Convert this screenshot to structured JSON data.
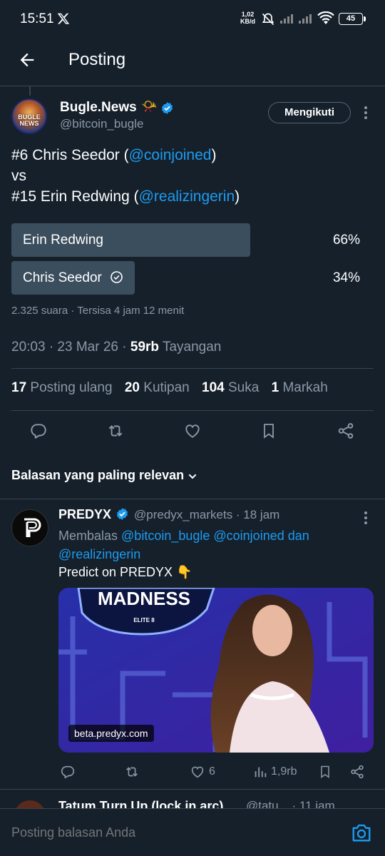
{
  "status_bar": {
    "time": "15:51",
    "net_speed_value": "1,02",
    "net_speed_unit": "KB/d",
    "battery": "45"
  },
  "header": {
    "title": "Posting"
  },
  "post": {
    "author_name": "Bugle.News",
    "author_emoji": "📯",
    "author_handle": "@bitcoin_bugle",
    "avatar_text": "BUGLE NEWS",
    "follow_label": "Mengikuti",
    "text_line1_pre": "#6 Chris Seedor (",
    "text_line1_mention": "@coinjoined",
    "text_line1_post": ")",
    "text_line2": "vs",
    "text_line3_pre": "#15 Erin Redwing (",
    "text_line3_mention": "@realizingerin",
    "text_line3_post": ")",
    "poll": {
      "options": [
        {
          "label": "Erin Redwing",
          "percent_label": "66%",
          "percent": 66,
          "selected": false
        },
        {
          "label": "Chris Seedor",
          "percent_label": "34%",
          "percent": 34,
          "selected": true
        }
      ],
      "meta": "2.325 suara · Tersisa 4 jam 12 menit"
    },
    "timestamp": "20:03 · 23 Mar 26 · ",
    "views_count": "59rb",
    "views_label": "Tayangan",
    "stats": {
      "reposts_count": "17",
      "reposts_label": "Posting ulang",
      "quotes_count": "20",
      "quotes_label": "Kutipan",
      "likes_count": "104",
      "likes_label": "Suka",
      "bookmarks_count": "1",
      "bookmarks_label": "Markah"
    }
  },
  "replies_section": {
    "sort_label": "Balasan yang paling relevan"
  },
  "reply": {
    "author_name": "PREDYX",
    "author_handle": "@predyx_markets · 18 jam",
    "replying_prefix": "Membalas ",
    "replying_mentions": "@bitcoin_bugle @coinjoined dan @realizingerin",
    "text": "Predict on PREDYX 👇",
    "media_domain": "beta.predyx.com",
    "media_banner": "MADNESS",
    "media_sub": "ELITE 8",
    "likes": "6",
    "views": "1,9rb"
  },
  "next_reply": {
    "author_name": "Tatum Turn Up (lock in arc)",
    "author_handle": "@tatu... · 11 jam"
  },
  "composer": {
    "placeholder": "Posting balasan Anda"
  },
  "colors": {
    "background": "#15202b",
    "accent": "#1d9bf0",
    "poll_bar": "#3b4e5e",
    "muted_text": "#8b98a5"
  }
}
